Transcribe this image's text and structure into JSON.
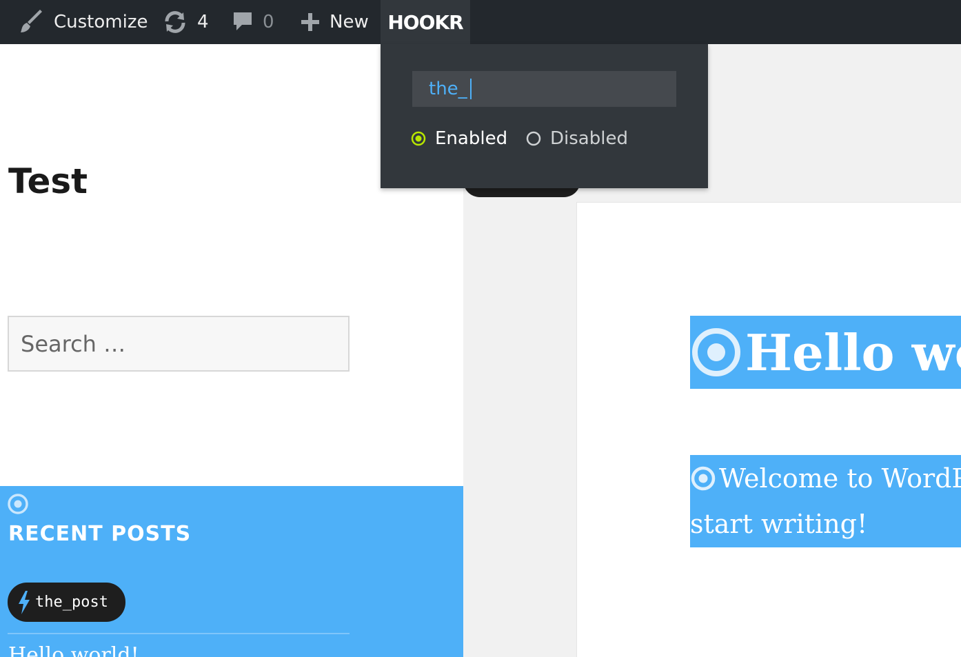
{
  "admin_bar": {
    "customize_label": "Customize",
    "updates_count": "4",
    "comments_count": "0",
    "new_label": "New",
    "plugin_logo": "HOOKR"
  },
  "sidebar": {
    "site_title": "Test",
    "search_placeholder": "Search …",
    "recent_posts": {
      "title": "RECENT POSTS",
      "hook_label": "the_post",
      "first_post": "Hello world!"
    }
  },
  "content": {
    "post_title": "Hello world!",
    "post_excerpt_line1": "Welcome to WordPress. This is your first post. Edit or delete it, then",
    "post_excerpt_line2": "start writing!"
  },
  "hookr_panel": {
    "filter_value": "the_",
    "options": [
      {
        "label": "Enabled",
        "selected": true
      },
      {
        "label": "Disabled",
        "selected": false
      }
    ]
  },
  "colors": {
    "admin_bar": "#23282d",
    "panel": "#32373c",
    "highlight": "#4eb0f8",
    "radio_active": "#b8e600"
  }
}
